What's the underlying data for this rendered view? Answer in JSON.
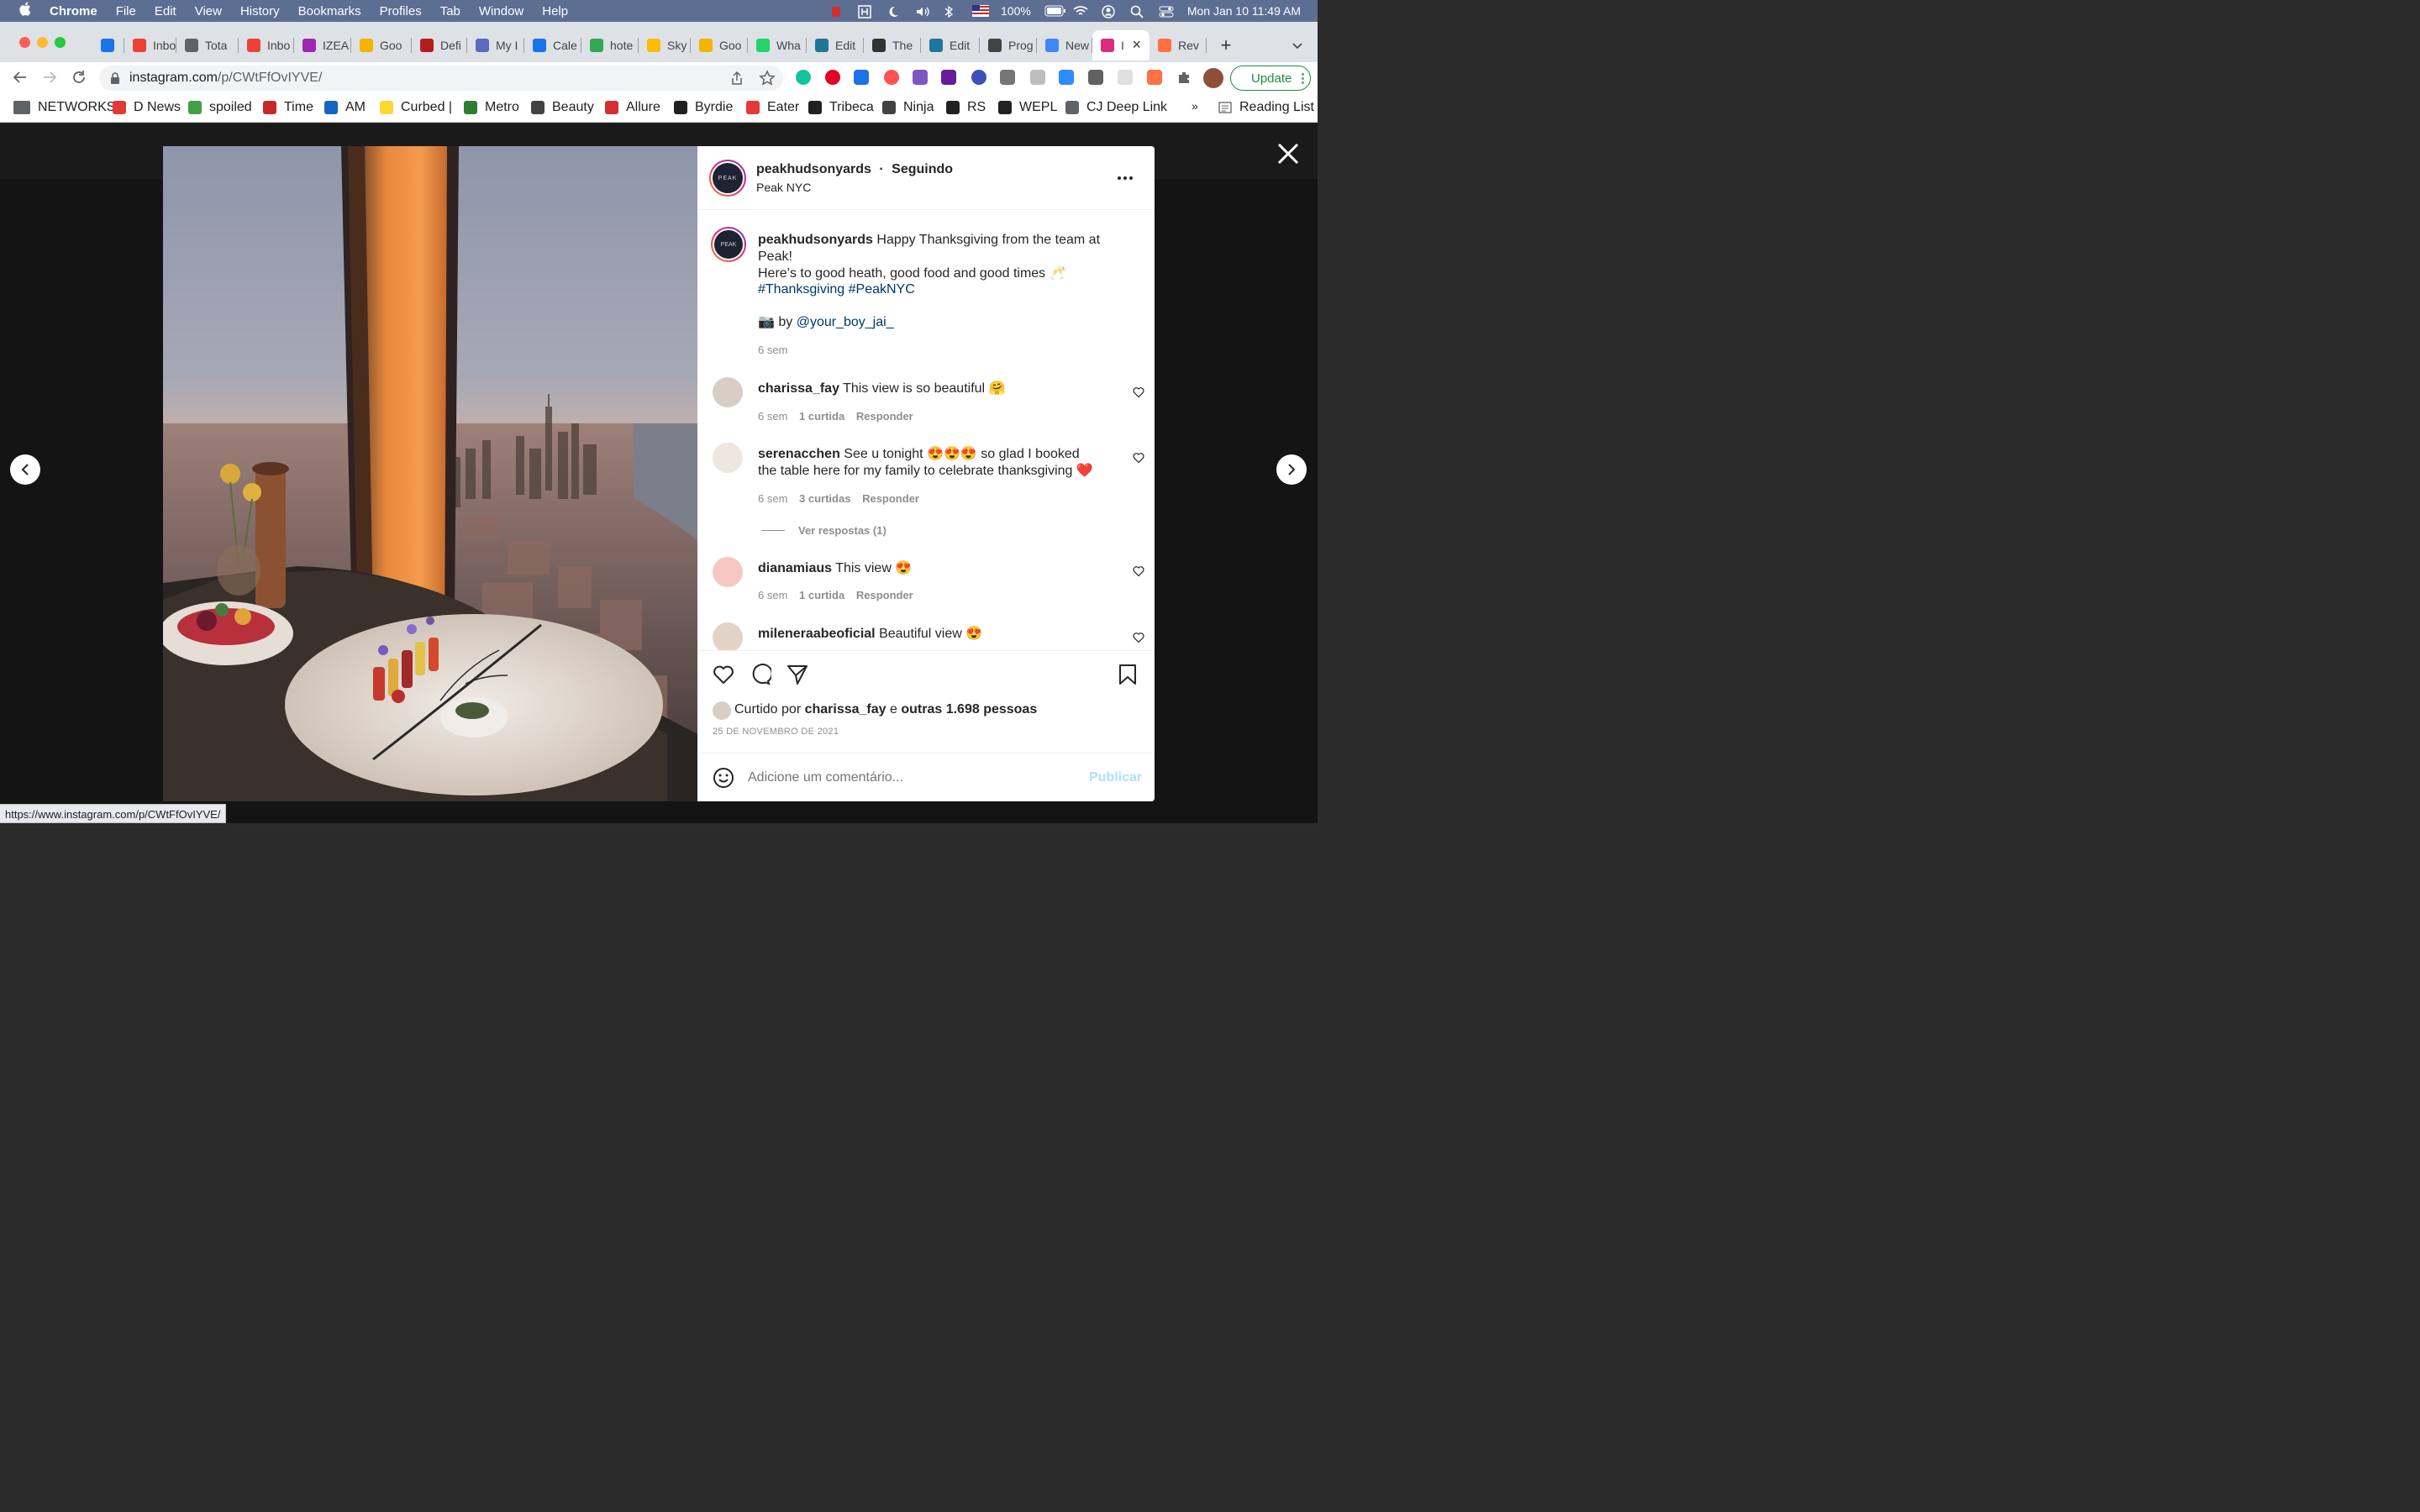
{
  "menubar": {
    "apple": "",
    "app": "Chrome",
    "items": [
      "File",
      "Edit",
      "View",
      "History",
      "Bookmarks",
      "Profiles",
      "Tab",
      "Window",
      "Help"
    ],
    "battery": "100%",
    "datetime": "Mon Jan 10  11:49 AM"
  },
  "tabs": [
    {
      "label": "",
      "color": "#1a73e8"
    },
    {
      "label": "Inbo",
      "color": "#ea4335"
    },
    {
      "label": "Tota",
      "color": "#5f6368"
    },
    {
      "label": "Inbo",
      "color": "#ea4335"
    },
    {
      "label": "IZEA",
      "color": "#9c27b0"
    },
    {
      "label": "Goo",
      "color": "#f4b400"
    },
    {
      "label": "Defi",
      "color": "#b71c1c"
    },
    {
      "label": "My I",
      "color": "#5c6bc0"
    },
    {
      "label": "Cale",
      "color": "#1a73e8"
    },
    {
      "label": "hote",
      "color": "#34a853"
    },
    {
      "label": "Sky",
      "color": "#fbbc04"
    },
    {
      "label": "Goo",
      "color": "#f4b400"
    },
    {
      "label": "Wha",
      "color": "#25d366"
    },
    {
      "label": "Edit",
      "color": "#21759b"
    },
    {
      "label": "The",
      "color": "#333333"
    },
    {
      "label": "Edit",
      "color": "#21759b"
    },
    {
      "label": "Prog",
      "color": "#444444"
    },
    {
      "label": "New",
      "color": "#4285f4"
    },
    {
      "label": "I",
      "color": "#dd2a7b",
      "active": true
    },
    {
      "label": "Rev",
      "color": "#ff7043"
    }
  ],
  "toolbar": {
    "url_host": "instagram.com",
    "url_path": "/p/CWtFfOvIYVE/",
    "update_label": "Update"
  },
  "bookmarks": [
    {
      "label": "NETWORKS",
      "color": "#5f6368"
    },
    {
      "label": "D News",
      "color": "#e53935"
    },
    {
      "label": "spoiled",
      "color": "#43a047"
    },
    {
      "label": "Time",
      "color": "#c62828"
    },
    {
      "label": "AM",
      "color": "#1565c0"
    },
    {
      "label": "Curbed |",
      "color": "#fdd835"
    },
    {
      "label": "Metro",
      "color": "#2e7d32"
    },
    {
      "label": "Beauty",
      "color": "#424242"
    },
    {
      "label": "Allure",
      "color": "#d32f2f"
    },
    {
      "label": "Byrdie",
      "color": "#212121"
    },
    {
      "label": "Eater",
      "color": "#e53935"
    },
    {
      "label": "Tribeca",
      "color": "#212121"
    },
    {
      "label": "Ninja",
      "color": "#424242"
    },
    {
      "label": "RS",
      "color": "#212121"
    },
    {
      "label": "WEPL",
      "color": "#212121"
    },
    {
      "label": "CJ Deep Link",
      "color": "#5f6368"
    }
  ],
  "bookmarks_overflow": "»",
  "reading_list": "Reading List",
  "post": {
    "username": "peakhudsonyards",
    "following": "Seguindo",
    "location": "Peak NYC",
    "caption_user": "peakhudsonyards",
    "caption_line1": "Happy Thanksgiving from the team at Peak!",
    "caption_line2": "Here’s to good heath, good food and good times 🥂",
    "hashtags": "#Thanksgiving #PeakNYC",
    "credit_prefix": "📷 by ",
    "credit_user": "@your_boy_jai_",
    "caption_time": "6 sem",
    "comments": [
      {
        "user": "charissa_fay",
        "text": "This view is so beautiful 🤗",
        "time": "6 sem",
        "likes": "1 curtida",
        "reply": "Responder"
      },
      {
        "user": "serenacchen",
        "text": "See u tonight 😍😍😍 so glad I booked the table here for my family to celebrate thanksgiving ❤️",
        "time": "6 sem",
        "likes": "3 curtidas",
        "reply": "Responder",
        "view_replies": "Ver respostas (1)"
      },
      {
        "user": "dianamiaus",
        "text": "This view 😍",
        "time": "6 sem",
        "likes": "1 curtida",
        "reply": "Responder"
      },
      {
        "user": "mileneraabeoficial",
        "text": "Beautiful view 😍"
      }
    ],
    "liked_prefix": "Curtido por ",
    "liked_user": "charissa_fay",
    "liked_mid": " e ",
    "liked_others": "outras 1.698 pessoas",
    "date": "25 DE NOVEMBRO DE 2021",
    "comment_placeholder": "Adicione um comentário...",
    "publish": "Publicar",
    "brand_text": "PEAK"
  },
  "status_url": "https://www.instagram.com/p/CWtFfOvIYVE/"
}
